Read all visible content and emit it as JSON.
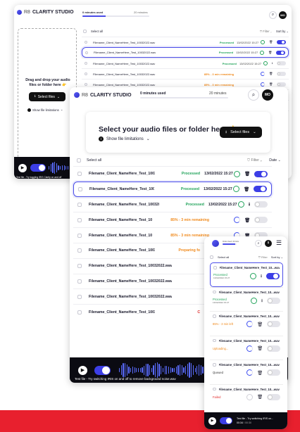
{
  "app": {
    "brand": "CLARITY STUDIO",
    "brand_prefix": "R8",
    "usage_label": "0 minutes used",
    "usage_total": "20 minutes",
    "usage_progress": 0,
    "avatar_initials": "MO",
    "mobile_usage_label": "0mins Used / 20 mins",
    "mobile_usage_progress": 0.9
  },
  "upload": {
    "title": "Select your audio files or folder here",
    "title_emoji": "👉",
    "select_label": "Select files",
    "limitations_label": "Show file limitations",
    "dropzone_label": "Drag and drop your audio files or folder here",
    "dropzone_emoji": "👉"
  },
  "list": {
    "select_all": "Select all",
    "filter_label": "Filter",
    "sort_label": "Sort by",
    "date_label": "Date"
  },
  "files": [
    {
      "name": "Filename_Client_NameHere_Test_10032022.wav",
      "status": "Processed",
      "status_color": "#21a35a",
      "date": "13/02/2022 15:27",
      "toggle": "on",
      "highlight": false
    },
    {
      "name": "Filename_Client_NameHere_Test_10032022.wav",
      "status": "Processed",
      "status_color": "#21a35a",
      "date": "13/02/2022 15:27",
      "toggle": "on",
      "highlight": true
    },
    {
      "name": "Filename_Client_NameHere_Test_10032022.wav",
      "status": "Processed",
      "status_color": "#21a35a",
      "date": "13/02/2022 15:27",
      "toggle": "off",
      "highlight": false
    },
    {
      "name": "Filename_Client_NameHere_Test_10032022.wav",
      "status": "85% - 3 min remaining",
      "status_color": "#f08a1d",
      "date": "",
      "toggle": "off",
      "highlight": false
    },
    {
      "name": "Filename_Client_NameHere_Test_10032022.wav",
      "status": "85% - 3 min remaining",
      "status_color": "#f08a1d",
      "date": "",
      "toggle": "off",
      "highlight": false
    },
    {
      "name": "Filename_Client_NameHere_Test_10032022.wav",
      "status": "Preparing fo",
      "status_color": "#f08a1d",
      "date": "",
      "toggle": "off",
      "highlight": false
    },
    {
      "name": "Filename_Client_NameHere_Test_10032022.wav",
      "status": "",
      "status_color": "#21a35a",
      "date": "",
      "toggle": "off",
      "highlight": false
    },
    {
      "name": "Filename_Client_NameHere_Test_10032022.wav",
      "status": "",
      "status_color": "#21a35a",
      "date": "",
      "toggle": "off",
      "highlight": false
    },
    {
      "name": "Filename_Client_NameHere_Test_10032022.wav",
      "status": "",
      "status_color": "#21a35a",
      "date": "",
      "toggle": "off",
      "highlight": false
    },
    {
      "name": "Filename_Client_NameHere_Test_10032022.wav",
      "status": "C",
      "status_color": "#e22a2a",
      "date": "",
      "toggle": "off",
      "highlight": false
    }
  ],
  "mobile_files": [
    {
      "name": "Filename_Client_NameHere_Test_10...wav",
      "status": "Processed",
      "date": "13/02/2022 15:27",
      "status_color": "#21a35a",
      "toggle": "on",
      "highlight": true
    },
    {
      "name": "Filename_Client_NameHere_Test_10...wav",
      "status": "Processed",
      "date": "13/02/2022 15:27",
      "status_color": "#21a35a",
      "toggle": "off",
      "highlight": false
    },
    {
      "name": "Filename_Client_NameHere_Test_10...wav",
      "status": "85% - 3 min left",
      "date": "",
      "status_color": "#f08a1d",
      "toggle": "off",
      "highlight": false
    },
    {
      "name": "Filename_Client_NameHere_Test_10...wav",
      "status": "Uploading...",
      "date": "",
      "status_color": "#f08a1d",
      "toggle": "off",
      "highlight": false
    },
    {
      "name": "Filename_Client_NameHere_Test_10...wav",
      "status": "Queued",
      "date": "",
      "status_color": "#333333",
      "toggle": "off",
      "highlight": false
    },
    {
      "name": "Filename_Client_NameHere_Test_10...wav",
      "status": "Failed",
      "date": "",
      "status_color": "#e22a2a",
      "toggle": "off",
      "highlight": false
    }
  ],
  "player": {
    "caption": "Test file - Try switching IRIS on and off to remove background noise.wav",
    "caption_back": "Test file - Try toggling IRIS Clarity on and off",
    "mobile_title": "Test file - Try switching IRIS on...",
    "mobile_time": "00:34",
    "mobile_duration": "/ 00:30"
  }
}
